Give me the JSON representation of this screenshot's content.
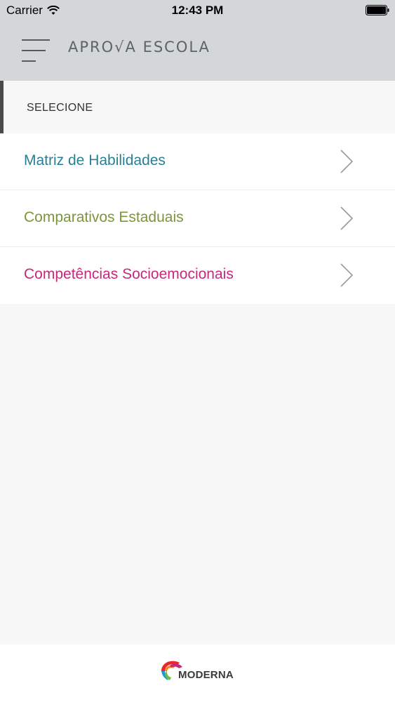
{
  "status_bar": {
    "carrier": "Carrier",
    "time": "12:43 PM"
  },
  "header": {
    "title": "APRO√A ESCOLA"
  },
  "section": {
    "label": "SELECIONE"
  },
  "menu": {
    "items": [
      {
        "label": "Matriz de Habilidades",
        "color": "#2a7f94"
      },
      {
        "label": "Comparativos Estaduais",
        "color": "#79973a"
      },
      {
        "label": "Competências Socioemocionais",
        "color": "#c7287a"
      }
    ]
  },
  "footer": {
    "brand": "MODERNA"
  },
  "colors": {
    "header_bg": "#d4d7d8",
    "page_bg": "#f7f7f7"
  }
}
